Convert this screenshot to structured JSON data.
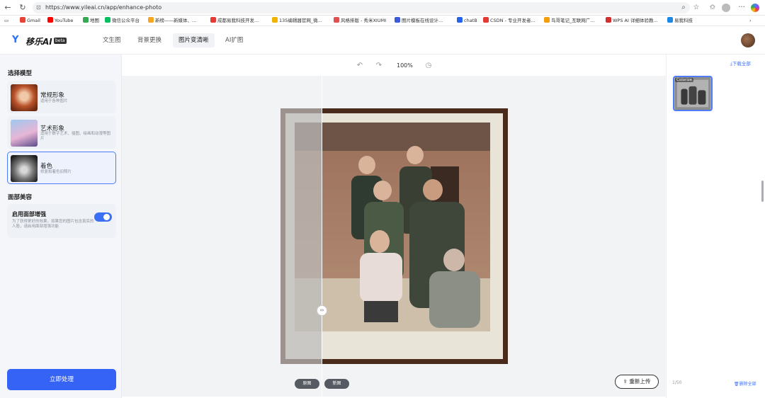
{
  "browser": {
    "url": "https://www.yileai.cn/app/enhance-photo",
    "bookmarks": [
      {
        "label": "Gmail",
        "color": "#ea4335"
      },
      {
        "label": "YouTube",
        "color": "#ff0000"
      },
      {
        "label": "地图",
        "color": "#34a853"
      },
      {
        "label": "微信公众平台",
        "color": "#07c160"
      },
      {
        "label": "新榜——新媒体、...",
        "color": "#f5a623"
      },
      {
        "label": "成都易我科技开发...",
        "color": "#e53935"
      },
      {
        "label": "135编辑器官网_微...",
        "color": "#f0b400"
      },
      {
        "label": "风格排版 - 秀米XIUMI",
        "color": "#e05050"
      },
      {
        "label": "图片模板在线设计...",
        "color": "#3b5bdb"
      },
      {
        "label": "chatB",
        "color": "#2563eb"
      },
      {
        "label": "CSDN - 专业开发者...",
        "color": "#e53935"
      },
      {
        "label": "鸟哥笔记_互联网广...",
        "color": "#f59e0b"
      },
      {
        "label": "WPS AI 详细体验教...",
        "color": "#d32f2f"
      },
      {
        "label": "易我科技",
        "color": "#1e88e5"
      }
    ]
  },
  "app": {
    "logo": "移乐AI",
    "beta": "beta",
    "nav": [
      "文生图",
      "背景更换",
      "图片变清晰",
      "AI扩图"
    ]
  },
  "left": {
    "model_title": "选择模型",
    "models": [
      {
        "title": "常规形象",
        "desc": "适用于各种图片"
      },
      {
        "title": "艺术形象",
        "desc": "适用于数字艺术、插图、绘画和动漫等图片"
      },
      {
        "title": "着色",
        "desc": "修复和着色旧照片"
      }
    ],
    "face_title": "面部美容",
    "face_toggle_label": "启用面部增强",
    "face_toggle_desc": "为了获得更好的效果，如果您的图片包含真实的人脸，请启用面部增强功能",
    "process_button": "立即处理"
  },
  "center": {
    "zoom": "100%",
    "before_label": "原图",
    "after_label": "新图",
    "reupload": "重新上传"
  },
  "right": {
    "download_all": "下载全部",
    "thumb_label": "Colorize",
    "count": "1/50",
    "delete_all": "删除全部"
  }
}
